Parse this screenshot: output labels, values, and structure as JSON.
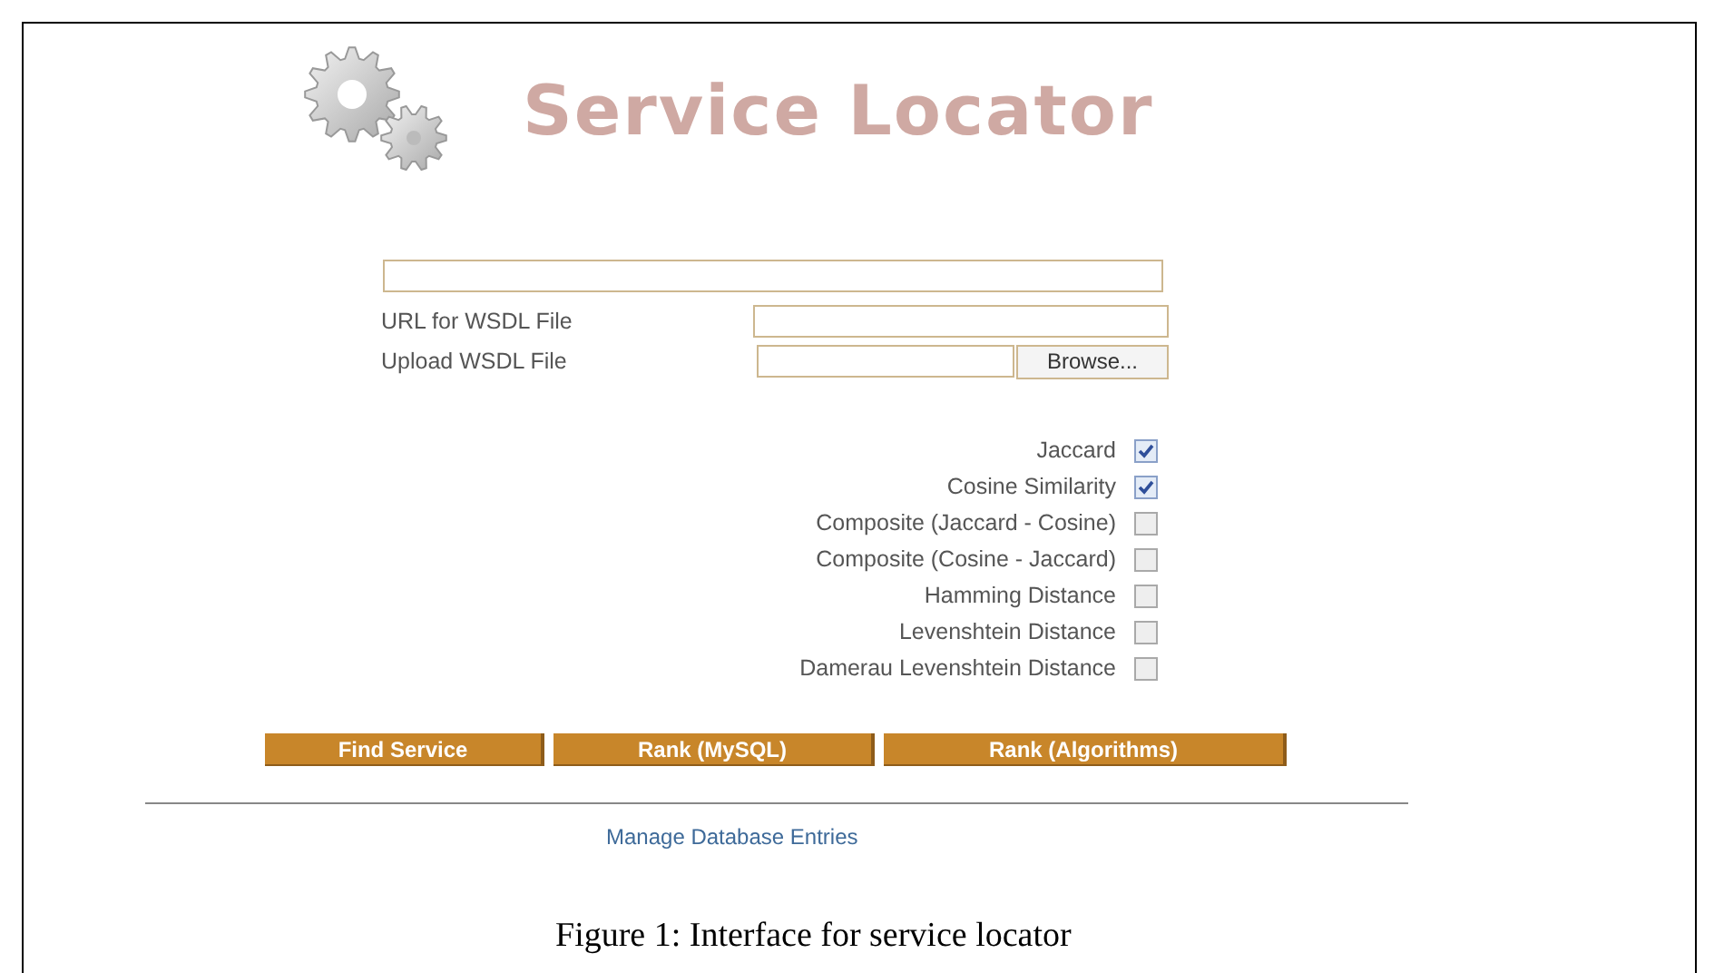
{
  "header": {
    "title": "Service Locator"
  },
  "fields": [
    {
      "label": "URL for WSDL File",
      "kind": "text"
    },
    {
      "label": "Upload WSDL File",
      "kind": "file",
      "button": "Browse..."
    }
  ],
  "algorithms": [
    {
      "label": "Jaccard",
      "checked": true
    },
    {
      "label": "Cosine Similarity",
      "checked": true
    },
    {
      "label": "Composite (Jaccard - Cosine)",
      "checked": false
    },
    {
      "label": "Composite (Cosine - Jaccard)",
      "checked": false
    },
    {
      "label": "Hamming Distance",
      "checked": false
    },
    {
      "label": "Levenshtein Distance",
      "checked": false
    },
    {
      "label": "Damerau Levenshtein Distance",
      "checked": false
    }
  ],
  "buttons": [
    "Find Service",
    "Rank (MySQL)",
    "Rank (Algorithms)"
  ],
  "link": "Manage Database Entries",
  "caption": "Figure 1: Interface for service locator"
}
